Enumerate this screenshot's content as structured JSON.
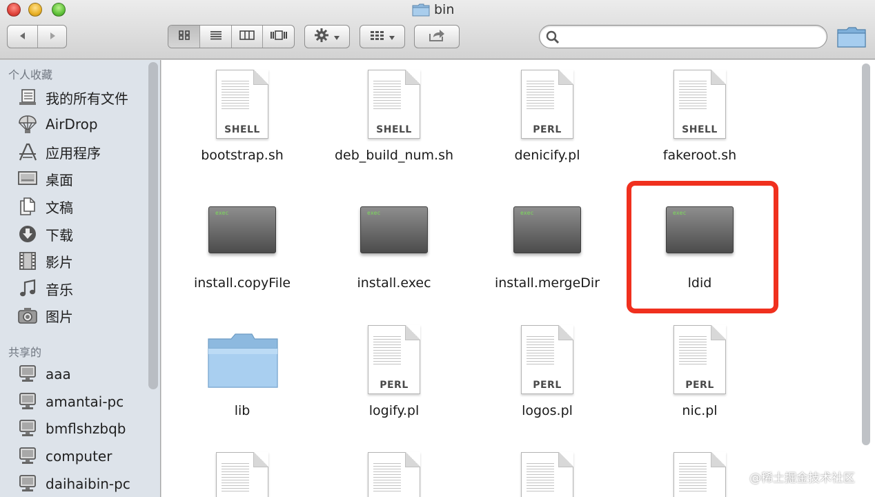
{
  "window": {
    "title": "bin"
  },
  "toolbar": {
    "back_icon": "chevron-left-icon",
    "forward_icon": "chevron-right-icon",
    "view_modes": [
      "icon-view",
      "list-view",
      "column-view",
      "cover-flow-view"
    ],
    "active_view": "icon-view",
    "action_icon": "gear-icon",
    "arrange_icon": "grid-arrange-icon",
    "share_icon": "share-icon",
    "search": {
      "value": "",
      "placeholder": ""
    }
  },
  "sidebar": {
    "favorites_header": "个人收藏",
    "favorites": [
      {
        "label": "我的所有文件",
        "icon": "all-files-icon"
      },
      {
        "label": "AirDrop",
        "icon": "airdrop-icon"
      },
      {
        "label": "应用程序",
        "icon": "applications-icon"
      },
      {
        "label": "桌面",
        "icon": "desktop-icon"
      },
      {
        "label": "文稿",
        "icon": "documents-icon"
      },
      {
        "label": "下载",
        "icon": "downloads-icon"
      },
      {
        "label": "影片",
        "icon": "movies-icon"
      },
      {
        "label": "音乐",
        "icon": "music-icon"
      },
      {
        "label": "图片",
        "icon": "pictures-icon"
      }
    ],
    "shared_header": "共享的",
    "shared": [
      {
        "label": "aaa",
        "icon": "computer-icon"
      },
      {
        "label": "amantai-pc",
        "icon": "computer-icon"
      },
      {
        "label": "bmflshzbqb",
        "icon": "computer-icon"
      },
      {
        "label": "computer",
        "icon": "computer-icon"
      },
      {
        "label": "daihaibin-pc",
        "icon": "computer-icon"
      }
    ]
  },
  "files": [
    {
      "name": "bootstrap.sh",
      "kind": "doc",
      "tag": "SHELL"
    },
    {
      "name": "deb_build_num.sh",
      "kind": "doc",
      "tag": "SHELL"
    },
    {
      "name": "denicify.pl",
      "kind": "doc",
      "tag": "PERL"
    },
    {
      "name": "fakeroot.sh",
      "kind": "doc",
      "tag": "SHELL"
    },
    {
      "name": "install.copyFile",
      "kind": "exec",
      "tag": "exec"
    },
    {
      "name": "install.exec",
      "kind": "exec",
      "tag": "exec"
    },
    {
      "name": "install.mergeDir",
      "kind": "exec",
      "tag": "exec"
    },
    {
      "name": "ldid",
      "kind": "exec",
      "tag": "exec",
      "highlighted": true
    },
    {
      "name": "lib",
      "kind": "folder",
      "tag": ""
    },
    {
      "name": "logify.pl",
      "kind": "doc",
      "tag": "PERL"
    },
    {
      "name": "logos.pl",
      "kind": "doc",
      "tag": "PERL"
    },
    {
      "name": "nic.pl",
      "kind": "doc",
      "tag": "PERL"
    },
    {
      "name": "",
      "kind": "doc",
      "tag": ""
    },
    {
      "name": "",
      "kind": "doc",
      "tag": ""
    },
    {
      "name": "",
      "kind": "doc",
      "tag": ""
    },
    {
      "name": "",
      "kind": "doc",
      "tag": ""
    }
  ],
  "highlight_color": "#f0301e",
  "watermark": "@稀土掘金技术社区"
}
